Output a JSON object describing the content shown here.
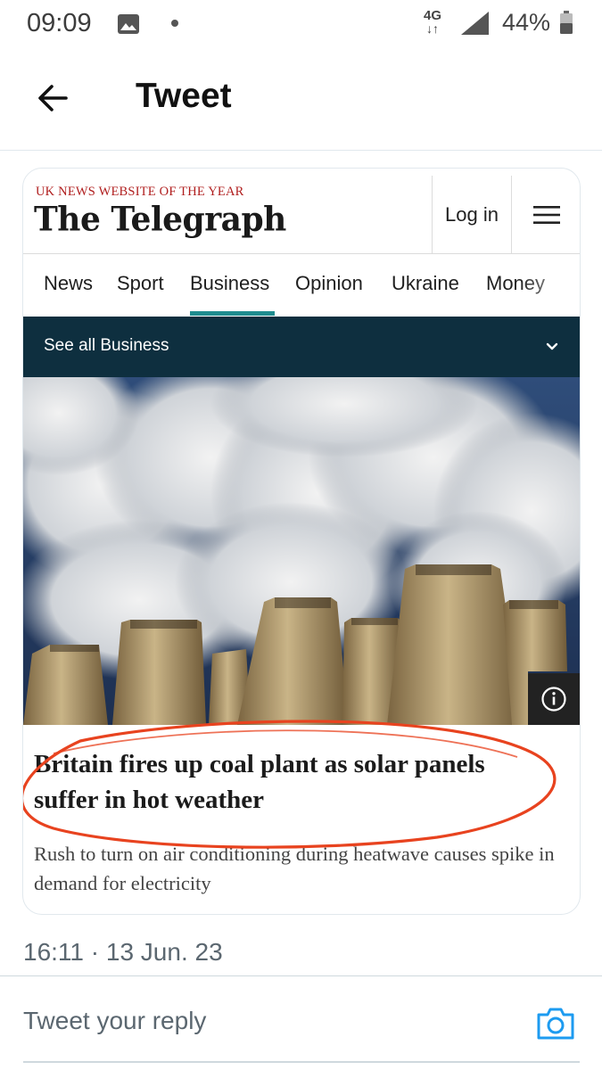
{
  "status_bar": {
    "time": "09:09",
    "network": "4G",
    "network_arrows": "↓↑",
    "battery": "44%"
  },
  "header": {
    "title": "Tweet"
  },
  "card": {
    "tagline": "UK NEWS WEBSITE OF THE YEAR",
    "logo": "The Telegraph",
    "login_label": "Log in",
    "nav": [
      "News",
      "Sport",
      "Business",
      "Opinion",
      "Ukraine",
      "Money"
    ],
    "active_nav": "Business",
    "see_all_label": "See all Business",
    "headline": "Britain fires up coal plant as solar panels suffer in hot weather",
    "standfirst": "Rush to turn on air conditioning during heatwave causes spike in demand for electricity",
    "annotation_color": "#e8431f",
    "nav_accent_color": "#1f8c8f",
    "banner_color": "#0e2f3f"
  },
  "tweet": {
    "timestamp": "16:11 · 13 Jun. 23"
  },
  "reply": {
    "placeholder": "Tweet your reply"
  },
  "icons": [
    "back-arrow-icon",
    "gallery-icon",
    "signal-icon",
    "battery-icon",
    "hamburger-menu-icon",
    "chevron-down-icon",
    "info-icon",
    "camera-icon"
  ]
}
